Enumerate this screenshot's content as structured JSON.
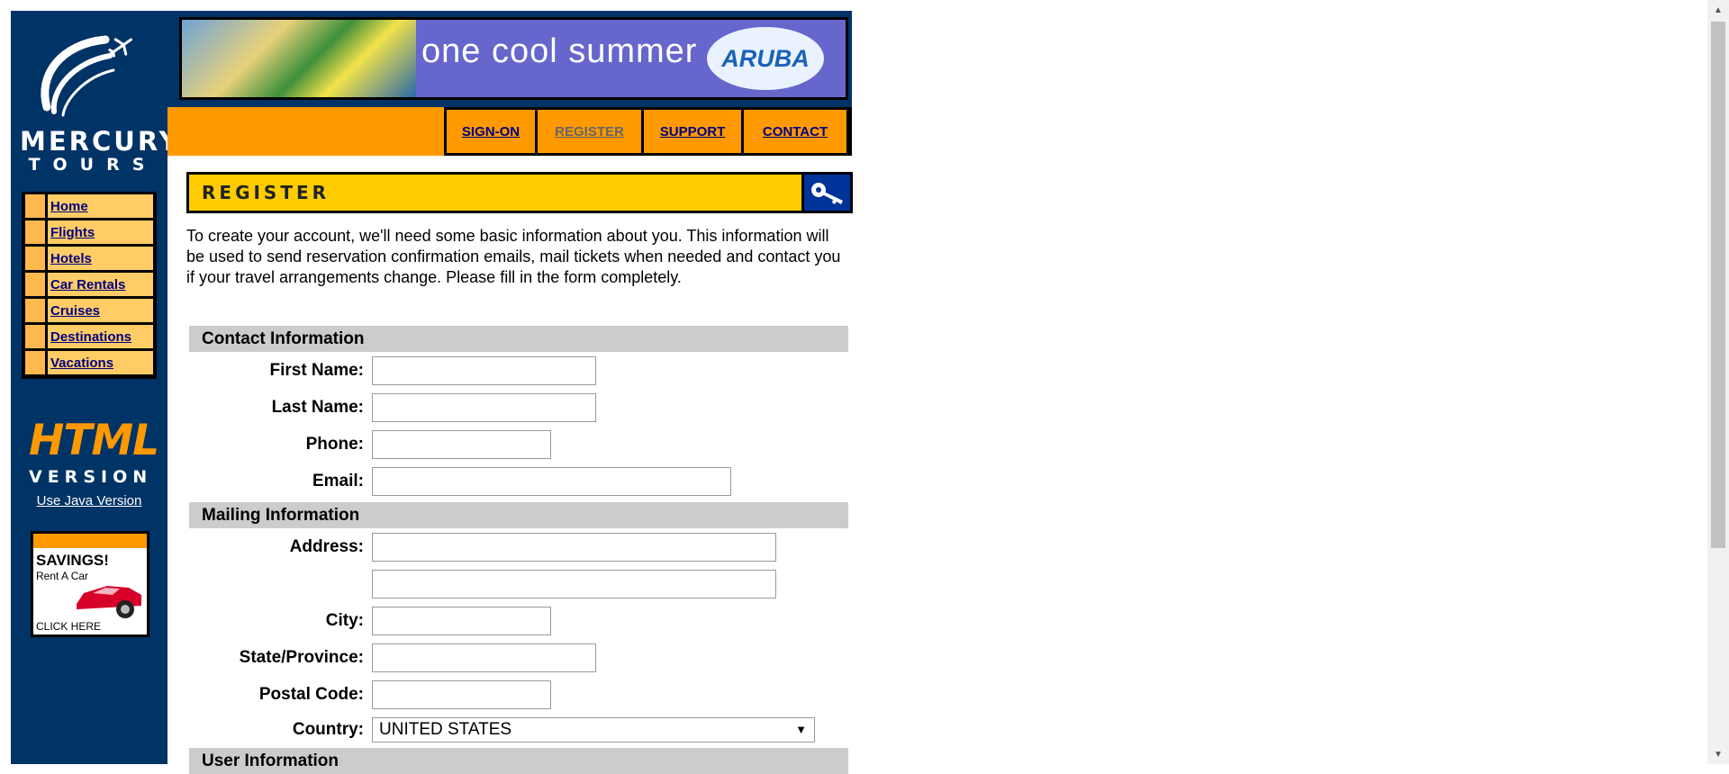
{
  "logo": {
    "line1": "MERCURY",
    "line2": "TOURS"
  },
  "left_nav": {
    "items": [
      {
        "label": "Home"
      },
      {
        "label": "Flights"
      },
      {
        "label": "Hotels"
      },
      {
        "label": "Car Rentals"
      },
      {
        "label": "Cruises"
      },
      {
        "label": "Destinations"
      },
      {
        "label": "Vacations"
      }
    ]
  },
  "html_badge": {
    "line1": "HTML",
    "line2": "VERSION"
  },
  "java_link": "Use Java Version",
  "savings_ad": {
    "line1": "SAVINGS!",
    "line2": "Rent A Car",
    "line3": "CLICK HERE"
  },
  "banner": {
    "slogan": "one cool summer",
    "brand": "ARUBA"
  },
  "top_nav": {
    "items": [
      {
        "label": "SIGN-ON",
        "active": false
      },
      {
        "label": "REGISTER",
        "active": true
      },
      {
        "label": "SUPPORT",
        "active": false
      },
      {
        "label": "CONTACT",
        "active": false
      }
    ]
  },
  "page": {
    "header": "REGISTER",
    "intro": "To create your account, we'll need some basic information about you. This information will be used to send reservation confirmation emails, mail tickets when needed and contact you if your travel arrangements change. Please fill in the form completely."
  },
  "form": {
    "contact_section": "Contact Information",
    "first_name_label": "First Name:",
    "last_name_label": "Last Name:",
    "phone_label": "Phone:",
    "email_label": "Email:",
    "mailing_section": "Mailing Information",
    "address_label": "Address:",
    "city_label": "City:",
    "state_label": "State/Province:",
    "postal_label": "Postal Code:",
    "country_label": "Country:",
    "country_value": "UNITED STATES",
    "user_section": "User Information"
  },
  "colors": {
    "sidebar_bg": "#003366",
    "nav_orange": "#FF9900",
    "header_yellow": "#FFCC00",
    "link_navy": "#000080",
    "section_gray": "#CCCCCC"
  }
}
